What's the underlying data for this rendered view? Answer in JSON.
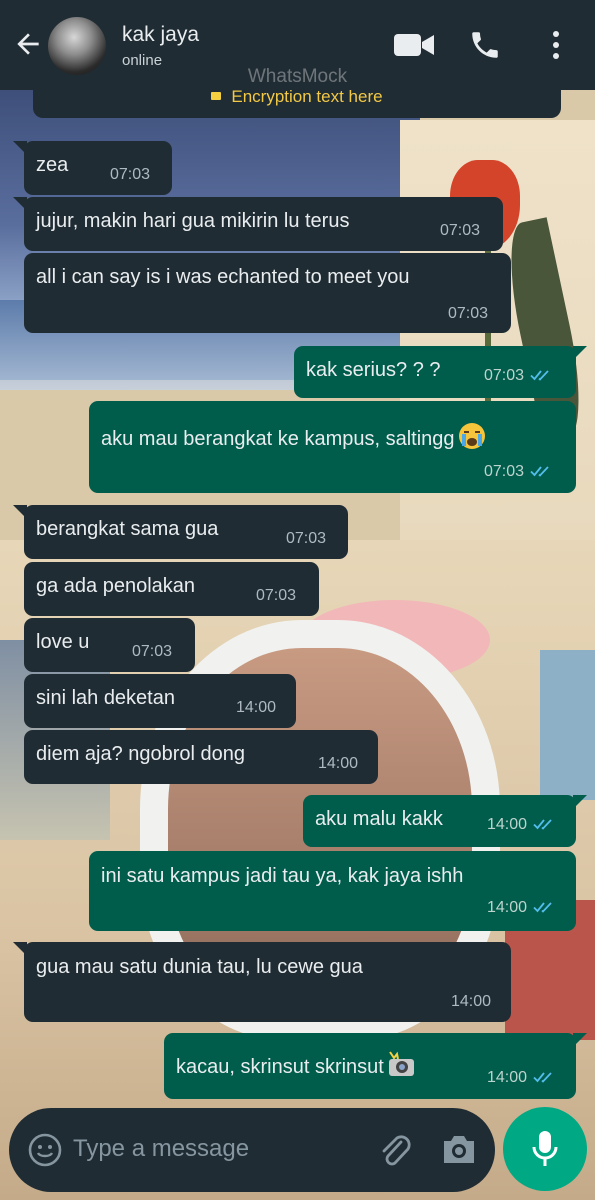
{
  "header": {
    "contact_name": "kak jaya",
    "status": "online"
  },
  "watermark": "WhatsMock",
  "encryption_text": "Encryption text here",
  "composer": {
    "placeholder": "Type a message"
  },
  "colors": {
    "header_bg": "#202c33",
    "incoming_bubble": "#202c33",
    "outgoing_bubble": "#005c4b",
    "read_ticks": "#53bdeb",
    "mic_button": "#00a884",
    "encryption_text": "#f3c845"
  },
  "messages": [
    {
      "dir": "in",
      "text": "zea",
      "time": "07:03"
    },
    {
      "dir": "in",
      "text": "jujur,  makin hari gua mikirin lu terus",
      "time": "07:03"
    },
    {
      "dir": "in",
      "text": "all i can say is i was echanted to meet you",
      "time": "07:03"
    },
    {
      "dir": "out",
      "text": "kak serius? ? ?",
      "time": "07:03",
      "status": "read"
    },
    {
      "dir": "out",
      "text": "aku mau berangkat ke kampus,  saltingg",
      "emoji": "loudly-crying-face",
      "time": "07:03",
      "status": "read"
    },
    {
      "dir": "in",
      "text": "berangkat sama gua",
      "time": "07:03"
    },
    {
      "dir": "in",
      "text": "ga ada penolakan",
      "time": "07:03"
    },
    {
      "dir": "in",
      "text": "love u",
      "time": "07:03"
    },
    {
      "dir": "in",
      "text": "sini lah deketan",
      "time": "14:00"
    },
    {
      "dir": "in",
      "text": "diem aja?  ngobrol dong",
      "time": "14:00"
    },
    {
      "dir": "out",
      "text": "aku malu kakk",
      "time": "14:00",
      "status": "read"
    },
    {
      "dir": "out",
      "text": "ini satu kampus jadi tau ya,  kak jaya ishh",
      "time": "14:00",
      "status": "read"
    },
    {
      "dir": "in",
      "text": "gua mau satu dunia tau,  lu cewe gua",
      "time": "14:00"
    },
    {
      "dir": "out",
      "text": "kacau,  skrinsut skrinsut",
      "emoji": "camera-with-flash",
      "time": "14:00",
      "status": "read"
    }
  ]
}
